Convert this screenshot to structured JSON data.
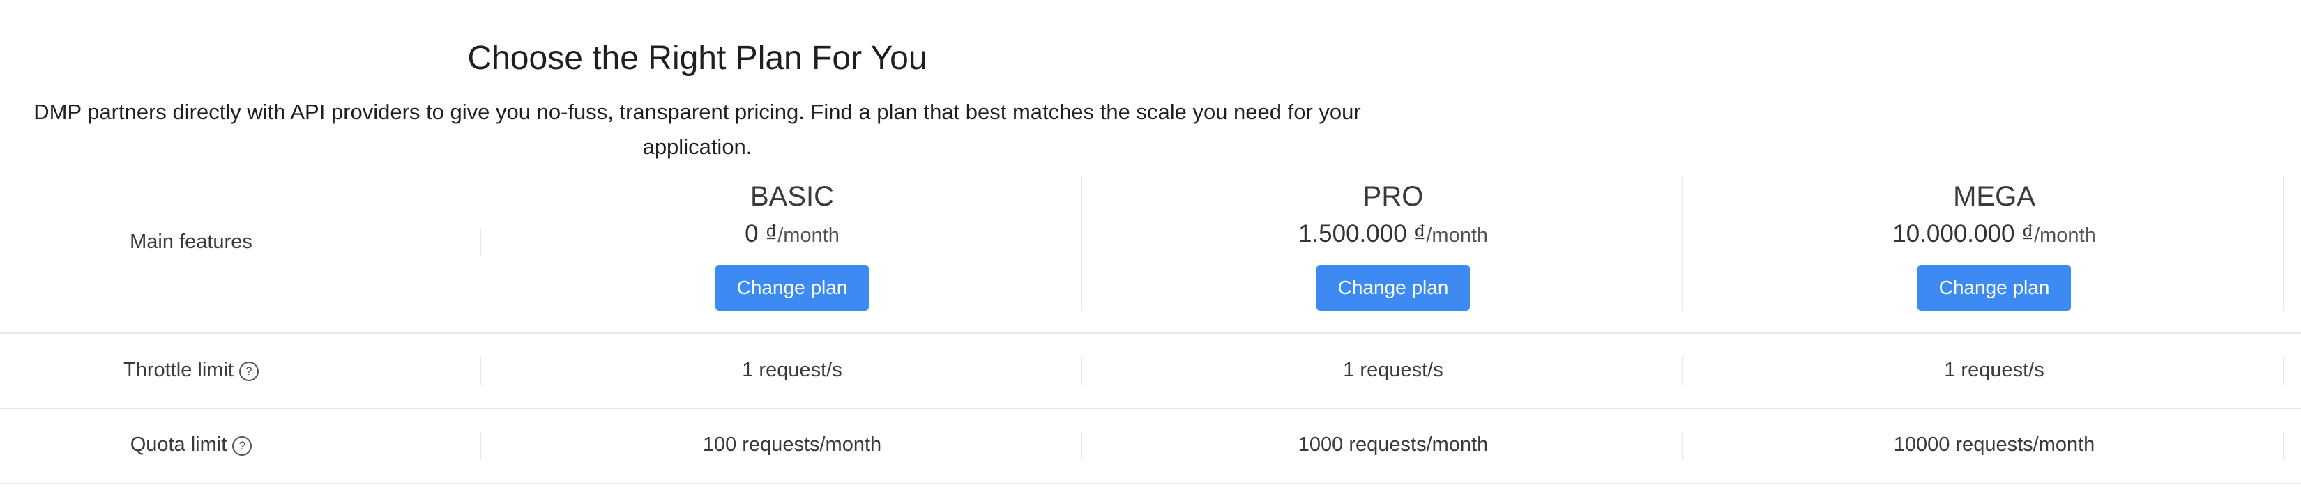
{
  "header": {
    "title": "Choose the Right Plan For You",
    "subtitle": "DMP partners directly with API providers to give you no-fuss, transparent pricing. Find a plan that best matches the scale you need for your application."
  },
  "rows": {
    "main_features_label": "Main features",
    "throttle_label": "Throttle limit",
    "quota_label": "Quota limit",
    "help_icon_glyph": "?"
  },
  "plans": [
    {
      "name": "BASIC",
      "price": "0 ₫",
      "unit": "/month",
      "button_label": "Change plan",
      "throttle": "1 request/s",
      "quota": "100 requests/month"
    },
    {
      "name": "PRO",
      "price": "1.500.000 ₫",
      "unit": "/month",
      "button_label": "Change plan",
      "throttle": "1 request/s",
      "quota": "1000 requests/month"
    },
    {
      "name": "MEGA",
      "price": "10.000.000 ₫",
      "unit": "/month",
      "button_label": "Change plan",
      "throttle": "1 request/s",
      "quota": "10000 requests/month"
    }
  ],
  "colors": {
    "button_bg": "#3d8bf2",
    "button_text": "#ffffff",
    "divider": "#e6e6e6"
  }
}
